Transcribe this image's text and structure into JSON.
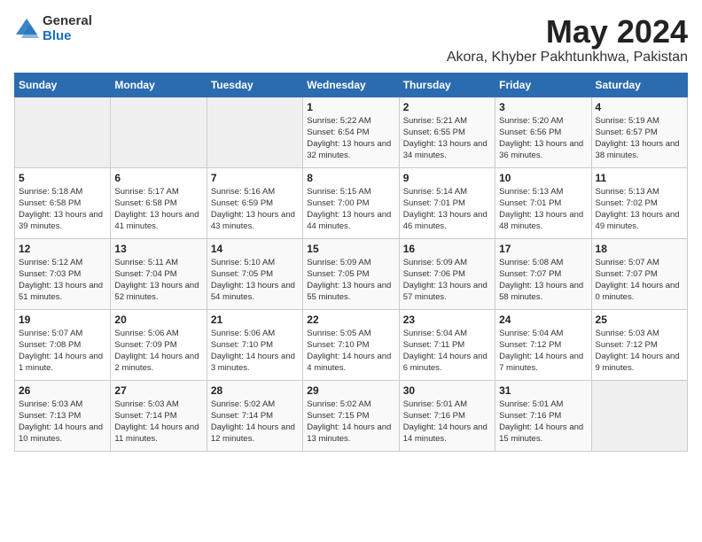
{
  "header": {
    "logo_general": "General",
    "logo_blue": "Blue",
    "month": "May 2024",
    "location": "Akora, Khyber Pakhtunkhwa, Pakistan"
  },
  "weekdays": [
    "Sunday",
    "Monday",
    "Tuesday",
    "Wednesday",
    "Thursday",
    "Friday",
    "Saturday"
  ],
  "weeks": [
    [
      {
        "day": "",
        "empty": true
      },
      {
        "day": "",
        "empty": true
      },
      {
        "day": "",
        "empty": true
      },
      {
        "day": "1",
        "sunrise": "5:22 AM",
        "sunset": "6:54 PM",
        "daylight": "13 hours and 32 minutes."
      },
      {
        "day": "2",
        "sunrise": "5:21 AM",
        "sunset": "6:55 PM",
        "daylight": "13 hours and 34 minutes."
      },
      {
        "day": "3",
        "sunrise": "5:20 AM",
        "sunset": "6:56 PM",
        "daylight": "13 hours and 36 minutes."
      },
      {
        "day": "4",
        "sunrise": "5:19 AM",
        "sunset": "6:57 PM",
        "daylight": "13 hours and 38 minutes."
      }
    ],
    [
      {
        "day": "5",
        "sunrise": "5:18 AM",
        "sunset": "6:58 PM",
        "daylight": "13 hours and 39 minutes."
      },
      {
        "day": "6",
        "sunrise": "5:17 AM",
        "sunset": "6:58 PM",
        "daylight": "13 hours and 41 minutes."
      },
      {
        "day": "7",
        "sunrise": "5:16 AM",
        "sunset": "6:59 PM",
        "daylight": "13 hours and 43 minutes."
      },
      {
        "day": "8",
        "sunrise": "5:15 AM",
        "sunset": "7:00 PM",
        "daylight": "13 hours and 44 minutes."
      },
      {
        "day": "9",
        "sunrise": "5:14 AM",
        "sunset": "7:01 PM",
        "daylight": "13 hours and 46 minutes."
      },
      {
        "day": "10",
        "sunrise": "5:13 AM",
        "sunset": "7:01 PM",
        "daylight": "13 hours and 48 minutes."
      },
      {
        "day": "11",
        "sunrise": "5:13 AM",
        "sunset": "7:02 PM",
        "daylight": "13 hours and 49 minutes."
      }
    ],
    [
      {
        "day": "12",
        "sunrise": "5:12 AM",
        "sunset": "7:03 PM",
        "daylight": "13 hours and 51 minutes."
      },
      {
        "day": "13",
        "sunrise": "5:11 AM",
        "sunset": "7:04 PM",
        "daylight": "13 hours and 52 minutes."
      },
      {
        "day": "14",
        "sunrise": "5:10 AM",
        "sunset": "7:05 PM",
        "daylight": "13 hours and 54 minutes."
      },
      {
        "day": "15",
        "sunrise": "5:09 AM",
        "sunset": "7:05 PM",
        "daylight": "13 hours and 55 minutes."
      },
      {
        "day": "16",
        "sunrise": "5:09 AM",
        "sunset": "7:06 PM",
        "daylight": "13 hours and 57 minutes."
      },
      {
        "day": "17",
        "sunrise": "5:08 AM",
        "sunset": "7:07 PM",
        "daylight": "13 hours and 58 minutes."
      },
      {
        "day": "18",
        "sunrise": "5:07 AM",
        "sunset": "7:07 PM",
        "daylight": "14 hours and 0 minutes."
      }
    ],
    [
      {
        "day": "19",
        "sunrise": "5:07 AM",
        "sunset": "7:08 PM",
        "daylight": "14 hours and 1 minute."
      },
      {
        "day": "20",
        "sunrise": "5:06 AM",
        "sunset": "7:09 PM",
        "daylight": "14 hours and 2 minutes."
      },
      {
        "day": "21",
        "sunrise": "5:06 AM",
        "sunset": "7:10 PM",
        "daylight": "14 hours and 3 minutes."
      },
      {
        "day": "22",
        "sunrise": "5:05 AM",
        "sunset": "7:10 PM",
        "daylight": "14 hours and 4 minutes."
      },
      {
        "day": "23",
        "sunrise": "5:04 AM",
        "sunset": "7:11 PM",
        "daylight": "14 hours and 6 minutes."
      },
      {
        "day": "24",
        "sunrise": "5:04 AM",
        "sunset": "7:12 PM",
        "daylight": "14 hours and 7 minutes."
      },
      {
        "day": "25",
        "sunrise": "5:03 AM",
        "sunset": "7:12 PM",
        "daylight": "14 hours and 9 minutes."
      }
    ],
    [
      {
        "day": "26",
        "sunrise": "5:03 AM",
        "sunset": "7:13 PM",
        "daylight": "14 hours and 10 minutes."
      },
      {
        "day": "27",
        "sunrise": "5:03 AM",
        "sunset": "7:14 PM",
        "daylight": "14 hours and 11 minutes."
      },
      {
        "day": "28",
        "sunrise": "5:02 AM",
        "sunset": "7:14 PM",
        "daylight": "14 hours and 12 minutes."
      },
      {
        "day": "29",
        "sunrise": "5:02 AM",
        "sunset": "7:15 PM",
        "daylight": "14 hours and 13 minutes."
      },
      {
        "day": "30",
        "sunrise": "5:01 AM",
        "sunset": "7:16 PM",
        "daylight": "14 hours and 14 minutes."
      },
      {
        "day": "31",
        "sunrise": "5:01 AM",
        "sunset": "7:16 PM",
        "daylight": "14 hours and 15 minutes."
      },
      {
        "day": "",
        "empty": true
      }
    ]
  ]
}
